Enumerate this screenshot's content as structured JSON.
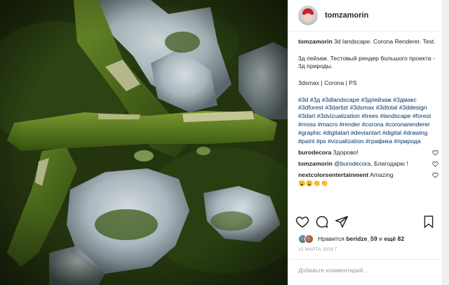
{
  "post": {
    "username": "tomzamorin",
    "caption_user": "tomzamorin",
    "caption_line1": "3d landscape. Corona Renderer. Test.",
    "caption_line2": "3д пейзаж. Тестовый рендер большого проекта - 3д природы.",
    "caption_line3": "3dsmax | Corona | PS",
    "hashtags": [
      "#3d",
      "#3д",
      "#3dlandscape",
      "#3дпейзаж",
      "#3дмакс",
      "#3dforest",
      "#3dartist",
      "#3dsmax",
      "#3dtotal",
      "#3ddesign",
      "#3dart",
      "#3dvizualization",
      "#trees",
      "#landscape",
      "#forest",
      "#moss",
      "#macro",
      "#render",
      "#corona",
      "#coronarenderer",
      "#graphic",
      "#digitalart",
      "#deviantart",
      "#digital",
      "#drawing",
      "#paint",
      "#ps",
      "#vizualization",
      "#графика",
      "#природа"
    ]
  },
  "comments": [
    {
      "user": "burodecora",
      "text": "Здорово!",
      "mention": "",
      "heart": "heart-outline-icon"
    },
    {
      "user": "tomzamorin",
      "mention": "@burodecora",
      "text": ", Благодарю !",
      "heart": "heart-outline-icon"
    },
    {
      "user": "nextcolorsentertainment",
      "text": "Amazing",
      "text2": "😮😮👏👏",
      "mention": "",
      "heart": "heart-outline-icon"
    }
  ],
  "actions": {
    "like": "heart-outline-icon",
    "comment": "comment-bubble-icon",
    "share": "share-plane-icon",
    "save": "bookmark-icon"
  },
  "likes": {
    "prefix": "Нравится",
    "user": "beridze_59",
    "middle": "и",
    "more": "ещё 82"
  },
  "date": "15 МАРТА 2018 Г.",
  "add_comment": {
    "placeholder": "Добавьте комментарий..."
  },
  "colors": {
    "link": "#003569",
    "text": "#262626",
    "muted": "#999999",
    "moss": "#2e4a12"
  }
}
